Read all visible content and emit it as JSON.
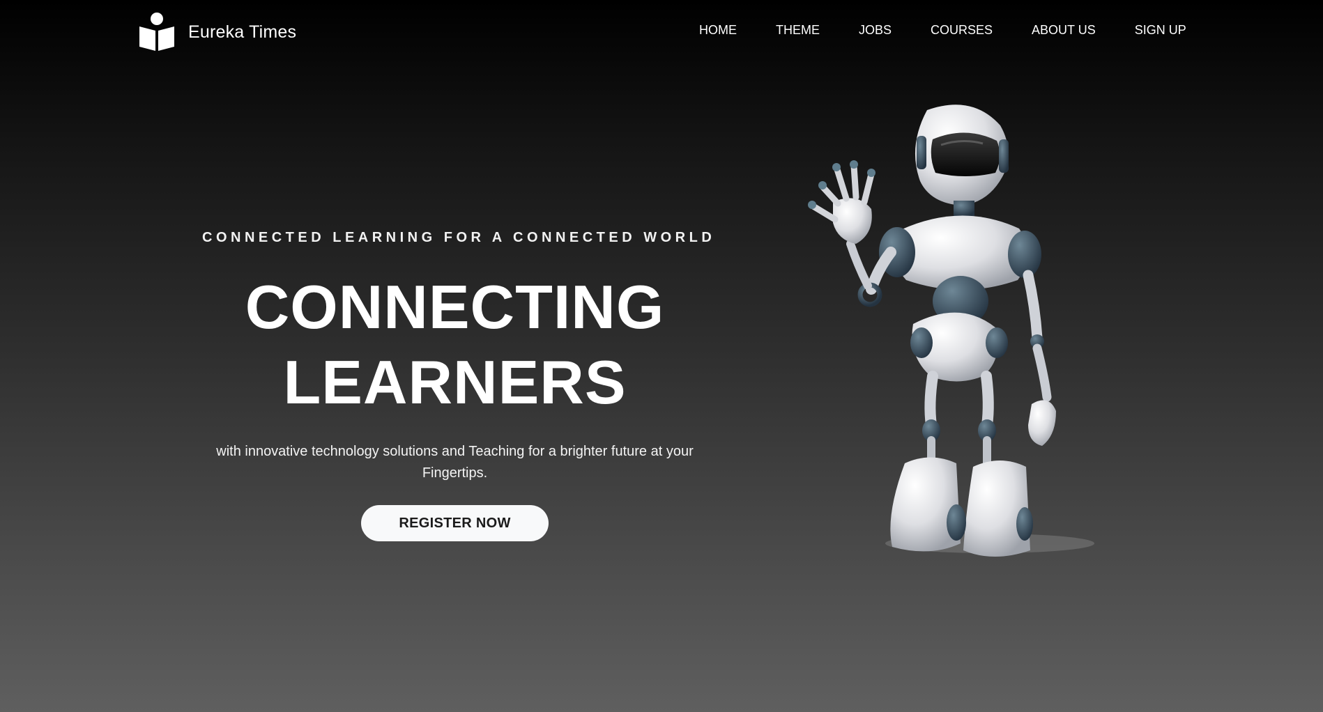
{
  "brand": {
    "name": "Eureka Times",
    "logo_icon": "book-reader-icon"
  },
  "nav": {
    "items": [
      {
        "label": "HOME"
      },
      {
        "label": "THEME"
      },
      {
        "label": "JOBS"
      },
      {
        "label": "COURSES"
      },
      {
        "label": "ABOUT US"
      },
      {
        "label": "SIGN UP"
      }
    ]
  },
  "hero": {
    "kicker": "CONNECTED LEARNING FOR A CONNECTED WORLD",
    "title_line1": "CONNECTING",
    "title_line2": "LEARNERS",
    "subtitle_line1": "with innovative technology solutions and Teaching for a brighter future at your",
    "subtitle_line2": "Fingertips.",
    "cta_label": "REGISTER NOW",
    "image": "waving-robot-illustration"
  },
  "colors": {
    "background_top": "#000000",
    "background_bottom": "#5f5f5f",
    "text": "#ffffff",
    "button_bg": "#f8f9fa",
    "button_text": "#1b1b1b"
  }
}
